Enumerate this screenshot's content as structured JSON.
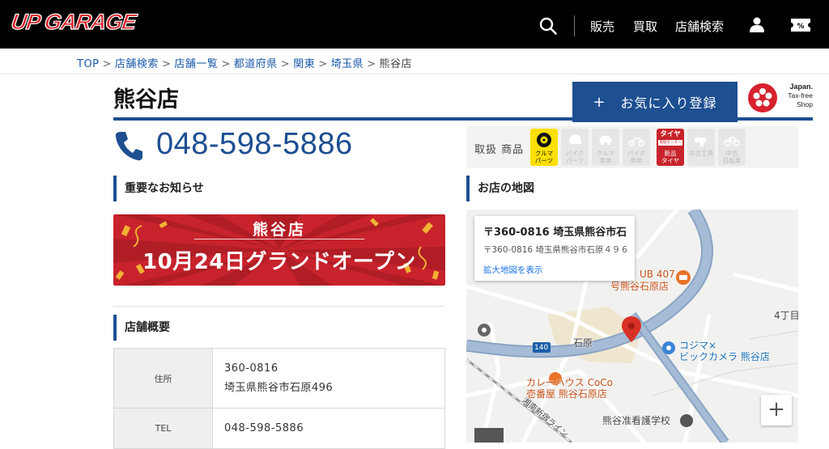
{
  "header": {
    "logo_text": "UP GARAGE",
    "nav": {
      "sell": "販売",
      "buy": "買取",
      "store_search": "店舗検索"
    },
    "icons": {
      "search": "search-icon",
      "user": "user-icon",
      "coupon": "coupon-icon"
    }
  },
  "breadcrumb": {
    "items": [
      "TOP",
      "店舗検索",
      "店舗一覧",
      "都道府県",
      "関東",
      "埼玉県"
    ],
    "current": "熊谷店",
    "separator": ">"
  },
  "store": {
    "name": "熊谷店",
    "favorite_label": "お気に入り登録",
    "favorite_icon": "+",
    "taxfree": {
      "line1": "Japan.",
      "line2": "Tax-free",
      "line3": "Shop"
    },
    "phone": "048-598-5886"
  },
  "handled": {
    "label": "取扱 商品",
    "categories": [
      {
        "label": "クルマ\nパーツ",
        "active": true,
        "icon": "tire-icon"
      },
      {
        "label": "バイク\nパーツ",
        "active": false,
        "icon": "helmet-icon"
      },
      {
        "label": "クルマ\n車体",
        "active": false,
        "icon": "car-icon"
      },
      {
        "label": "バイク\n車体",
        "active": false,
        "icon": "motorbike-icon"
      },
      {
        "label": "新品\nタイヤ",
        "top": "タイヤ",
        "sub": "取扱センター",
        "active": true,
        "icon": "new-tire-icon"
      },
      {
        "label": "中古工具",
        "active": false,
        "icon": "tool-icon"
      },
      {
        "label": "中古\n自転車",
        "active": false,
        "icon": "bicycle-icon"
      }
    ]
  },
  "sections": {
    "notice": "重要なお知らせ",
    "overview": "店舗概要",
    "map": "お店の地図"
  },
  "banner": {
    "store": "熊谷店",
    "date": "10月24日グランドオープン"
  },
  "overview": {
    "address_label": "住所",
    "postal": "360-0816",
    "address": "埼玉県熊谷市石原496",
    "tel_label": "TEL",
    "tel": "048-598-5886"
  },
  "map": {
    "card_title": "〒360-0816 埼玉県熊谷市石原...",
    "card_address": "〒360-0816 埼玉県熊谷市石原４９６",
    "card_link": "拡大地図を表示",
    "labels": {
      "pub": "UB 407",
      "pub2": "号熊谷石原店",
      "ishihara": "石原",
      "kojima1": "コジマ×",
      "kojima2": "ビックカメラ 熊谷店",
      "coco1": "カレーハウス CoCo",
      "coco2": "壱番屋 熊谷石原店",
      "nursing": "熊谷准看護学校",
      "chome": "4丁目",
      "route": "140",
      "road": "湘南新宿ライン"
    },
    "zoom_in": "+"
  },
  "colors": {
    "brand_blue": "#1d4f91",
    "link_blue": "#1a5aa8",
    "banner_red": "#c8232c",
    "header_bg": "#000000"
  }
}
